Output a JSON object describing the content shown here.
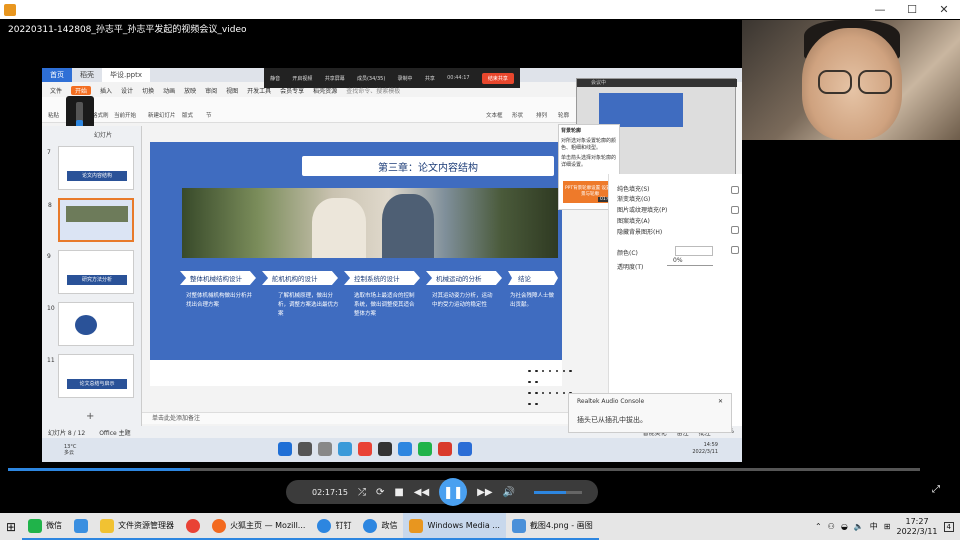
{
  "window": {
    "min": "—",
    "max": "☐",
    "close": "✕"
  },
  "video_title": "20220311-142808_孙志平_孙志平发起的视频会议_video",
  "inner": {
    "tabs": [
      {
        "label": "首页"
      },
      {
        "label": "稻壳"
      },
      {
        "label": "毕设.pptx"
      }
    ],
    "meeting_bar": {
      "items": [
        "静音",
        "开启视频",
        "共享屏幕",
        "成员(34/35)",
        "录制中",
        "共享"
      ],
      "timer": "00:44:17",
      "leave": "结束共享"
    },
    "menu": [
      "文件",
      "开始",
      "插入",
      "设计",
      "切换",
      "动画",
      "放映",
      "审阅",
      "视图",
      "开发工具",
      "会员专享",
      "稻壳资源"
    ],
    "menu_active": "开始",
    "search_placeholder": "查找命令、搜索模板",
    "ribbon": {
      "paste": "粘贴",
      "format": "格式刷",
      "from_current": "当前开始",
      "new_slide": "新建幻灯片",
      "layout": "版式",
      "section": "节",
      "textbox": "文本框",
      "shape": "形状",
      "arrange": "排列",
      "outline": "轮廓"
    },
    "volume": {
      "value": "80"
    },
    "thumbs_header": "幻灯片",
    "thumbs": [
      {
        "num": "7",
        "caption": "论文内容结构"
      },
      {
        "num": "8",
        "caption": ""
      },
      {
        "num": "9",
        "caption": "研究方法分析"
      },
      {
        "num": "10",
        "caption": ""
      },
      {
        "num": "11",
        "caption": "论文总结与启示"
      }
    ],
    "add_slide": "+",
    "slide": {
      "title": "第三章：论文内容结构",
      "steps": [
        {
          "label": "整体机械结构设计",
          "desc": "对整体机械机构做出分析并找出合理方案"
        },
        {
          "label": "舵机机构的设计",
          "desc": "了解机械原理，做出分析，调整方案选出最优方案"
        },
        {
          "label": "控制系统的设计",
          "desc": "选取市场上最适合的控制系统，做出调整使其适合整体方案"
        },
        {
          "label": "机械运动的分析",
          "desc": "对其运动姿力分析，运动中的受力运动的稳定性"
        },
        {
          "label": "结论",
          "desc": "为社会残障人士做出贡献。"
        }
      ]
    },
    "notes": "单击此处添加备注",
    "tooltip": {
      "title": "背景轮廓",
      "body1": "对所选对象设置轮廓的颜色、粗细和线型。",
      "body2": "单击箭头选择对象轮廓的详细设置。",
      "btn": "PPT背景轮廓设置 设置背景与轮廓",
      "dur": "01:00"
    },
    "share_title": "会议中",
    "rpanel": {
      "options": [
        "纯色填充(S)",
        "渐变填充(G)",
        "图片或纹理填充(P)",
        "图案填充(A)",
        "隐藏背景图形(H)"
      ],
      "color_label": "颜色(C)",
      "transparency_label": "透明度(T)",
      "transparency_value": "0%"
    },
    "status": {
      "slide": "幻灯片 8 / 12",
      "theme": "Office 主题",
      "smart": "智能美化",
      "notes": "备注",
      "comment": "批注",
      "zoom": "88%"
    },
    "taskbar": {
      "temp": "13°C",
      "weather": "多云",
      "time": "14:59",
      "date": "2022/3/11",
      "lang": "中"
    },
    "realtek": {
      "title": "Realtek Audio Console",
      "message": "插头已从插孔中拔出。",
      "close": "✕"
    }
  },
  "webcam_label": "",
  "player": {
    "time": "02:17:15",
    "progress": 0.2,
    "volume": 0.66,
    "fullscreen": "⤢"
  },
  "taskbar": {
    "start": "⊞",
    "items": [
      {
        "label": "微信",
        "color": "#20b34a"
      },
      {
        "label": "",
        "color": "#3a8fe0"
      },
      {
        "label": "文件资源管理器",
        "color": "#f1c232"
      },
      {
        "label": "",
        "color": "#e94235"
      },
      {
        "label": "火狐主页 — Mozill...",
        "color": "#f36a1f"
      },
      {
        "label": "钉钉",
        "color": "#2d86e0"
      },
      {
        "label": "政信",
        "color": "#2d86e0"
      },
      {
        "label": "Windows Media ...",
        "color": "#e8961f"
      },
      {
        "label": "截图4.png - 画图",
        "color": "#4a90d9"
      }
    ],
    "tray": {
      "caret": "⌃",
      "lang": "中",
      "time": "17:27",
      "date": "2022/3/11",
      "notif": "4"
    }
  }
}
